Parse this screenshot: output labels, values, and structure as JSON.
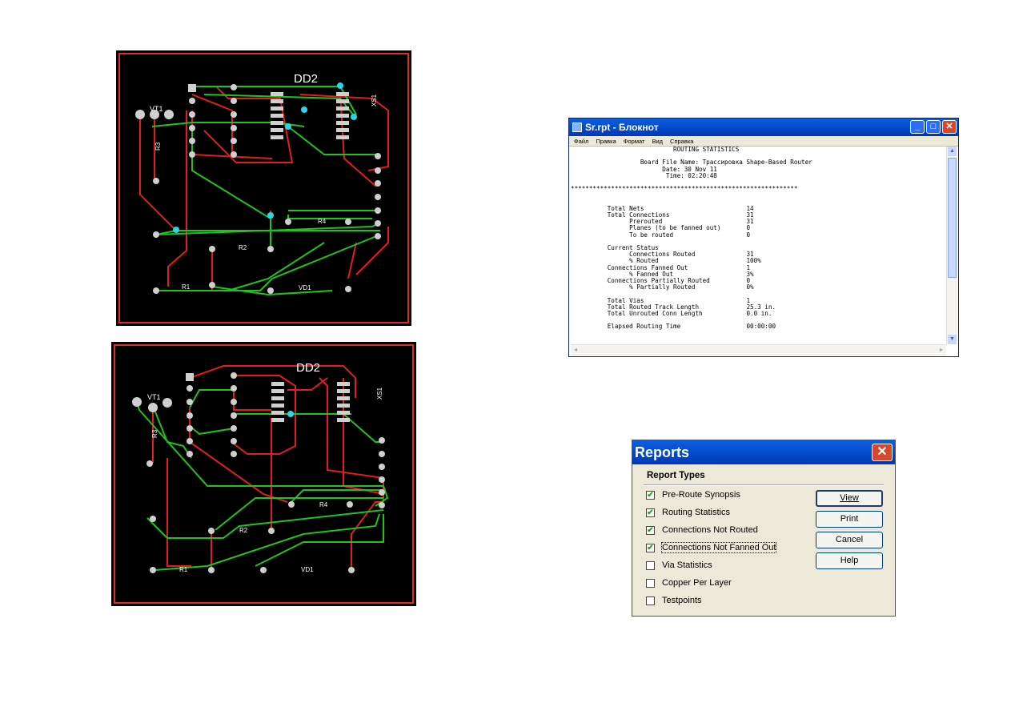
{
  "pcb_top": {
    "labels": {
      "dd": "DD2",
      "vt": "VT1",
      "xs": "XS1",
      "r3": "R3",
      "r4": "R4",
      "r2": "R2",
      "r1": "R1",
      "vd": "VD1"
    }
  },
  "pcb_bottom": {
    "labels": {
      "dd": "DD2",
      "vt": "VT1",
      "xs": "XS1",
      "r3": "R3",
      "r4": "R4",
      "r2": "R2",
      "r1": "R1",
      "vd": "VD1"
    }
  },
  "notepad": {
    "title": "Sr.rpt - Блокнот",
    "menu": [
      "Файл",
      "Правка",
      "Формат",
      "Вид",
      "Справка"
    ],
    "lines": [
      "                            ROUTING STATISTICS",
      "",
      "                   Board File Name: Трассировка Shape-Based Router",
      "                         Date: 30 Nov 11",
      "                          Time: 02:20:48",
      "",
      "**************************************************************",
      "",
      "",
      "          Total Nets                            14",
      "          Total Connections                     31",
      "                Prerouted                       31",
      "                Planes (to be fanned out)       0",
      "                To be routed                    0",
      "",
      "          Current Status",
      "                Connections Routed              31",
      "                % Routed                        100%",
      "          Connections Fanned Out                1",
      "                % Fanned Out                    3%",
      "          Connections Partially Routed          0",
      "                % Partially Routed              0%",
      "",
      "          Total Vias                            1",
      "          Total Routed Track Length             25.3 in.",
      "          Total Unrouted Conn Length            0.0 in.",
      "",
      "          Elapsed Routing Time                  00:00:00"
    ],
    "icons": {
      "app": "notepad-icon",
      "min": "minimize-icon",
      "max": "maximize-icon",
      "close": "close-icon"
    }
  },
  "reports": {
    "title": "Reports",
    "group_label": "Report Types",
    "items": [
      {
        "label": "Pre-Route Synopsis",
        "checked": true
      },
      {
        "label": "Routing Statistics",
        "checked": true
      },
      {
        "label": "Connections Not Routed",
        "checked": true
      },
      {
        "label": "Connections Not Fanned Out",
        "checked": true
      },
      {
        "label": "Via Statistics",
        "checked": false
      },
      {
        "label": "Copper Per Layer",
        "checked": false
      },
      {
        "label": "Testpoints",
        "checked": false
      }
    ],
    "buttons": {
      "view": "View",
      "print": "Print",
      "cancel": "Cancel",
      "help": "Help"
    },
    "close_glyph": "✕",
    "check_glyph": "✔"
  }
}
